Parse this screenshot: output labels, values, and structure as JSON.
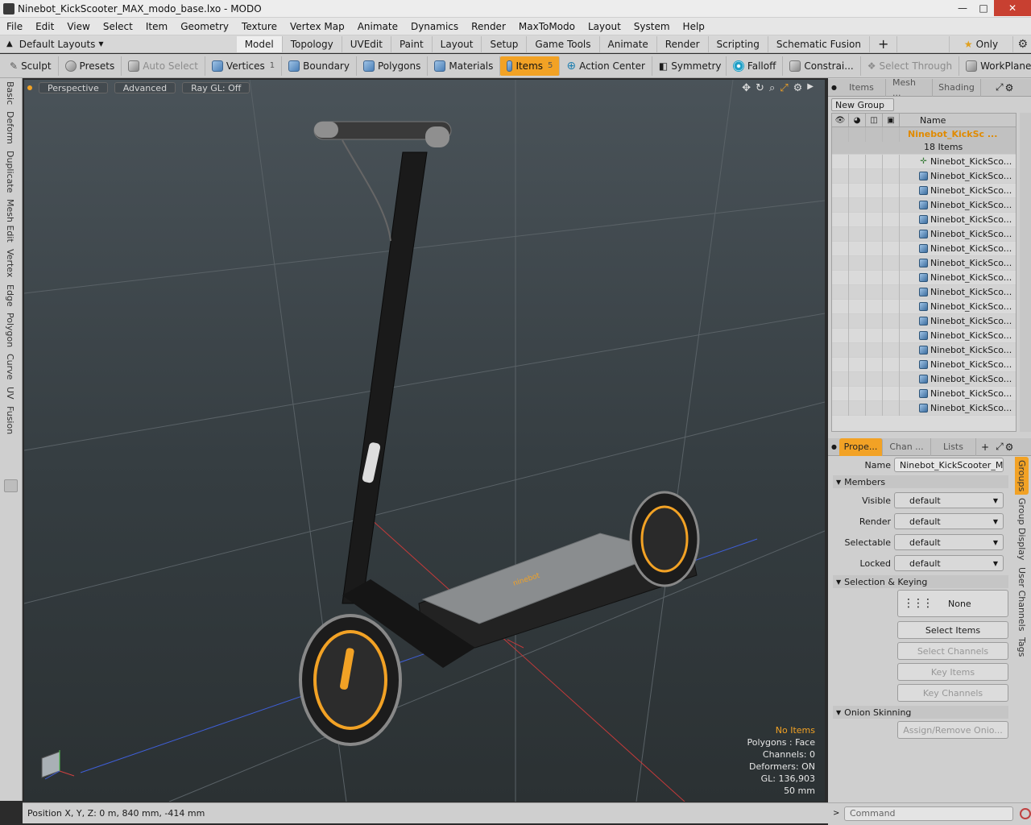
{
  "window": {
    "title": "Ninebot_KickScooter_MAX_modo_base.lxo - MODO"
  },
  "menu": [
    "File",
    "Edit",
    "View",
    "Select",
    "Item",
    "Geometry",
    "Texture",
    "Vertex Map",
    "Animate",
    "Dynamics",
    "Render",
    "MaxToModo",
    "Layout",
    "System",
    "Help"
  ],
  "layouts": {
    "dropdown": "Default Layouts",
    "tabs": [
      "Model",
      "Topology",
      "UVEdit",
      "Paint",
      "Layout",
      "Setup",
      "Game Tools",
      "Animate",
      "Render",
      "Scripting",
      "Schematic Fusion"
    ],
    "active_tab": "Model",
    "only_label": "Only"
  },
  "toolbar": {
    "sculpt": "Sculpt",
    "presets": "Presets",
    "auto_select": "Auto Select",
    "vertices": "Vertices",
    "vertices_count": "1",
    "boundary": "Boundary",
    "polygons": "Polygons",
    "materials": "Materials",
    "items": "Items",
    "items_count": "5",
    "action_center": "Action Center",
    "symmetry": "Symmetry",
    "falloff": "Falloff",
    "constraints": "Constrai...",
    "select_through": "Select Through",
    "workplane": "WorkPlane"
  },
  "left_tabs": [
    "Basic",
    "Deform",
    "Duplicate",
    "Mesh Edit",
    "Vertex",
    "Edge",
    "Polygon",
    "Curve",
    "UV",
    "Fusion"
  ],
  "viewport": {
    "view": "Perspective",
    "advanced": "Advanced",
    "raygl": "Ray GL: Off",
    "info": {
      "items": "No Items",
      "polygons": "Polygons : Face",
      "channels": "Channels: 0",
      "deformers": "Deformers: ON",
      "gl": "GL: 136,903",
      "scale": "50 mm"
    }
  },
  "status": {
    "position": "Position X, Y, Z:   0 m, 840 mm, -414 mm"
  },
  "items_panel": {
    "tabs": [
      "Items",
      "Mesh ...",
      "Shading"
    ],
    "new_group": "New Group",
    "name_header": "Name",
    "group_name": "Ninebot_KickSc ...",
    "group_count": "18 Items",
    "items": [
      "Ninebot_KickSco...",
      "Ninebot_KickSco...",
      "Ninebot_KickSco...",
      "Ninebot_KickSco...",
      "Ninebot_KickSco...",
      "Ninebot_KickSco...",
      "Ninebot_KickSco...",
      "Ninebot_KickSco...",
      "Ninebot_KickSco...",
      "Ninebot_KickSco...",
      "Ninebot_KickSco...",
      "Ninebot_KickSco...",
      "Ninebot_KickSco...",
      "Ninebot_KickSco...",
      "Ninebot_KickSco...",
      "Ninebot_KickSco...",
      "Ninebot_KickSco...",
      "Ninebot_KickSco..."
    ]
  },
  "properties": {
    "tabs": [
      "Prope...",
      "Chan ...",
      "Lists"
    ],
    "name_label": "Name",
    "name_value": "Ninebot_KickScooter_MAX",
    "members": "Members",
    "visible_label": "Visible",
    "visible": "default",
    "render_label": "Render",
    "render": "default",
    "selectable_label": "Selectable",
    "selectable": "default",
    "locked_label": "Locked",
    "locked": "default",
    "selection_keying": "Selection & Keying",
    "none": "None",
    "select_items": "Select Items",
    "select_channels": "Select Channels",
    "key_items": "Key Items",
    "key_channels": "Key Channels",
    "onion": "Onion Skinning",
    "assign_onion": "Assign/Remove Onio...",
    "side_tabs": [
      "Groups",
      "Group Display",
      "User Channels",
      "Tags"
    ]
  },
  "command": {
    "placeholder": "Command"
  }
}
